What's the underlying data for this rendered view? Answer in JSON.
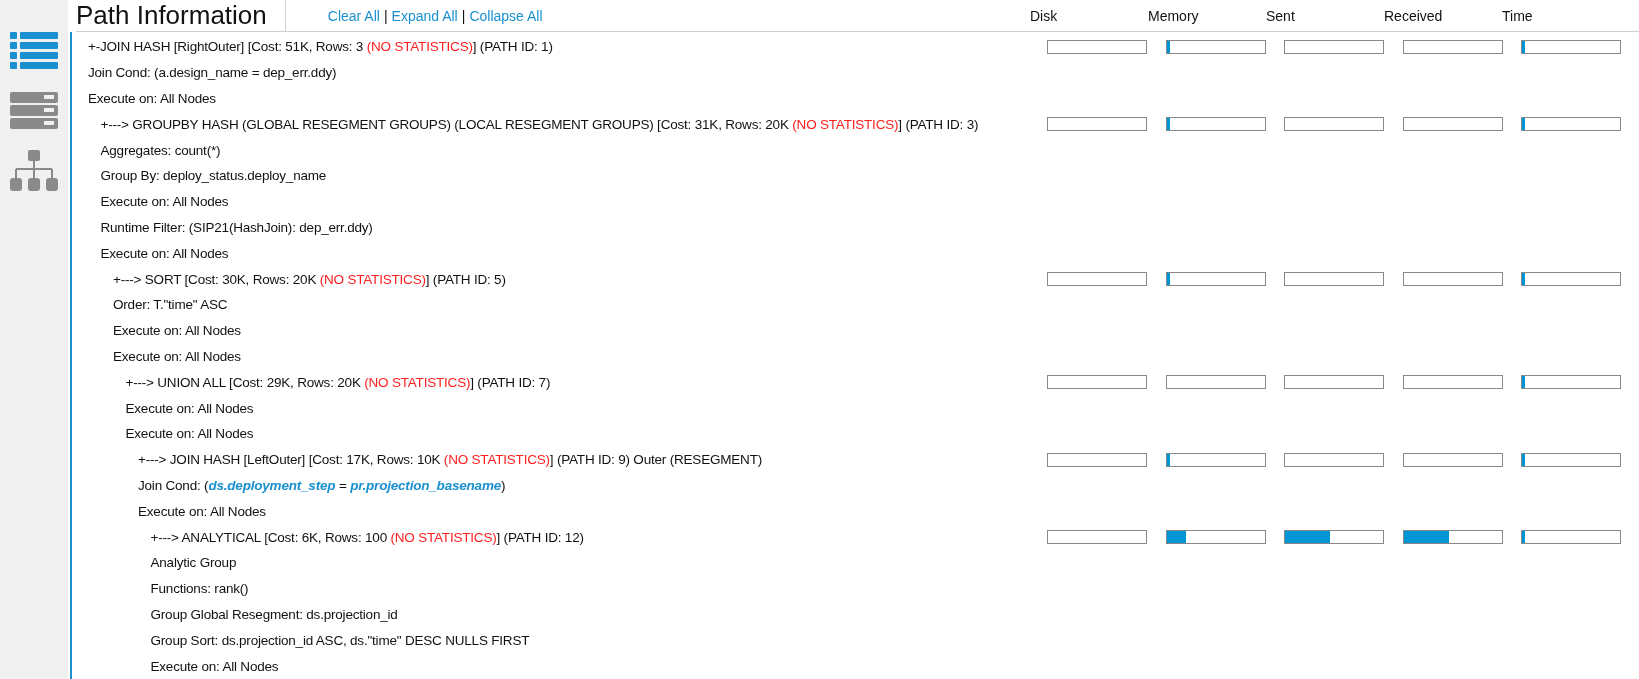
{
  "sidebar": {
    "items": [
      {
        "selected": true
      },
      {
        "selected": false
      },
      {
        "selected": false
      }
    ]
  },
  "header": {
    "title": "Path Information",
    "actions": [
      {
        "kind": "link",
        "text": "Clear All"
      },
      {
        "kind": "separator",
        "text": "|"
      },
      {
        "kind": "link",
        "text": "Expand All"
      },
      {
        "kind": "separator",
        "text": "|"
      },
      {
        "kind": "link",
        "text": "Collapse All"
      }
    ],
    "columns": [
      "Disk",
      "Memory",
      "Sent",
      "Received",
      "Time"
    ]
  },
  "plan": {
    "title": [
      {
        "text": "+-JOIN HASH [RightOuter] [Cost: 51K, Rows: 3 "
      },
      {
        "text": "(NO STATISTICS)",
        "warning": true
      },
      {
        "text": "] (PATH ID: 1)"
      }
    ],
    "metrics": [
      {
        "level": 0
      },
      {
        "level": 0.02
      },
      {
        "level": 0
      },
      {
        "level": 0
      },
      {
        "level": 0.02
      }
    ],
    "details": [
      [
        {
          "text": "Join Cond: (a.design_name = dep_err.ddy)"
        }
      ],
      [
        {
          "text": "Execute on: All Nodes"
        }
      ]
    ],
    "children": [
      {
        "title": [
          {
            "text": "+---> GROUPBY HASH (GLOBAL RESEGMENT GROUPS) (LOCAL RESEGMENT GROUPS) [Cost: 31K, Rows: 20K "
          },
          {
            "text": "(NO STATISTICS)",
            "warning": true
          },
          {
            "text": "] (PATH ID: 3)"
          }
        ],
        "metrics": [
          {
            "level": 0
          },
          {
            "level": 0.03
          },
          {
            "level": 0
          },
          {
            "level": 0
          },
          {
            "level": 0.02
          }
        ],
        "details": [
          [
            {
              "text": "Aggregates: count(*)"
            }
          ],
          [
            {
              "text": "Group By: deploy_status.deploy_name"
            }
          ],
          [
            {
              "text": "Execute on: All Nodes"
            }
          ],
          [
            {
              "text": "Runtime Filter: (SIP21(HashJoin): dep_err.ddy)"
            }
          ],
          [
            {
              "text": "Execute on: All Nodes"
            }
          ]
        ],
        "children": [
          {
            "title": [
              {
                "text": "+---> SORT [Cost: 30K, Rows: 20K "
              },
              {
                "text": "(NO STATISTICS)",
                "warning": true
              },
              {
                "text": "] (PATH ID: 5)"
              }
            ],
            "metrics": [
              {
                "level": 0
              },
              {
                "level": 0.02
              },
              {
                "level": 0
              },
              {
                "level": 0
              },
              {
                "level": 0.02
              }
            ],
            "details": [
              [
                {
                  "text": "Order: T.\"time\" ASC"
                }
              ],
              [
                {
                  "text": "Execute on: All Nodes"
                }
              ],
              [
                {
                  "text": "Execute on: All Nodes"
                }
              ]
            ],
            "children": [
              {
                "title": [
                  {
                    "text": "+---> UNION ALL [Cost: 29K, Rows: 20K "
                  },
                  {
                    "text": "(NO STATISTICS)",
                    "warning": true
                  },
                  {
                    "text": "] (PATH ID: 7)"
                  }
                ],
                "metrics": [
                  {
                    "level": 0
                  },
                  {
                    "level": 0
                  },
                  {
                    "level": 0
                  },
                  {
                    "level": 0
                  },
                  {
                    "level": 0.02
                  }
                ],
                "details": [
                  [
                    {
                      "text": "Execute on: All Nodes"
                    }
                  ],
                  [
                    {
                      "text": "Execute on: All Nodes"
                    }
                  ]
                ],
                "children": [
                  {
                    "title": [
                      {
                        "text": "+---> JOIN HASH [LeftOuter] [Cost: 17K, Rows: 10K "
                      },
                      {
                        "text": "(NO STATISTICS)",
                        "warning": true
                      },
                      {
                        "text": "] (PATH ID: 9) Outer (RESEGMENT)"
                      }
                    ],
                    "metrics": [
                      {
                        "level": 0
                      },
                      {
                        "level": 0.01
                      },
                      {
                        "level": 0
                      },
                      {
                        "level": 0
                      },
                      {
                        "level": 0.01
                      }
                    ],
                    "details": [
                      [
                        {
                          "text": "Join Cond: ("
                        },
                        {
                          "text": "ds.deployment_step",
                          "highlight": true
                        },
                        {
                          "text": " = "
                        },
                        {
                          "text": "pr.projection_basename",
                          "highlight": true
                        },
                        {
                          "text": ")"
                        }
                      ],
                      [
                        {
                          "text": "Execute on: All Nodes"
                        }
                      ]
                    ],
                    "children": [
                      {
                        "title": [
                          {
                            "text": "+---> ANALYTICAL [Cost: 6K, Rows: 100 "
                          },
                          {
                            "text": "(NO STATISTICS)",
                            "warning": true
                          },
                          {
                            "text": "] (PATH ID: 12)"
                          }
                        ],
                        "metrics": [
                          {
                            "level": 0
                          },
                          {
                            "level": 0.2
                          },
                          {
                            "level": 0.46
                          },
                          {
                            "level": 0.46
                          },
                          {
                            "level": 0.02
                          }
                        ],
                        "details": [
                          [
                            {
                              "text": "Analytic Group"
                            }
                          ],
                          [
                            {
                              "text": "Functions: rank()"
                            }
                          ],
                          [
                            {
                              "text": "Group Global Resegment: ds.projection_id"
                            }
                          ],
                          [
                            {
                              "text": "Group Sort: ds.projection_id ASC, ds.\"time\" DESC NULLS FIRST"
                            }
                          ],
                          [
                            {
                              "text": "Execute on: All Nodes"
                            }
                          ]
                        ]
                      }
                    ]
                  }
                ]
              }
            ]
          }
        ]
      }
    ]
  }
}
